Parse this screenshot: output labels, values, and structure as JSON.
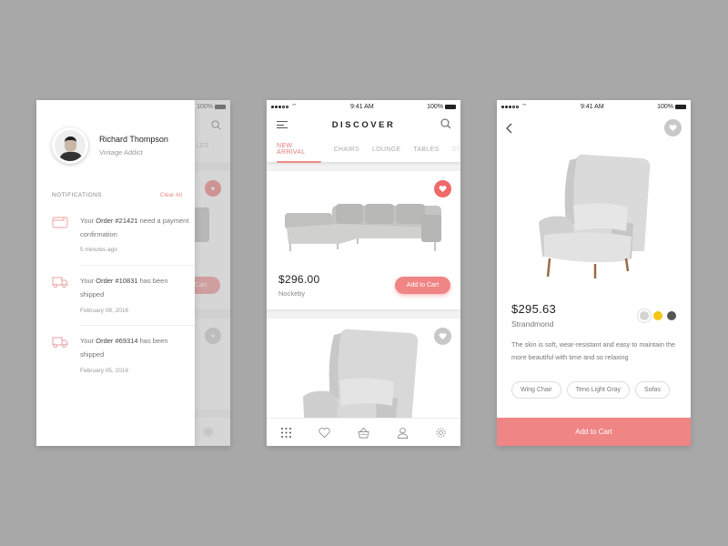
{
  "status_bar": {
    "time": "9:41 AM",
    "battery": "100%"
  },
  "drawer_screen": {
    "profile": {
      "name": "Richard Thompson",
      "subtitle": "Vintage Addict"
    },
    "notifications_title": "NOTIFICATIONS",
    "clear_all": "Clear All",
    "notifications": [
      {
        "icon": "wallet-icon",
        "prefix": "Your ",
        "order": "Order #21421",
        "suffix": " need a payment confirmation",
        "time": "5 minutes ago"
      },
      {
        "icon": "delivery-truck-icon",
        "prefix": "Your ",
        "order": "Order #10831",
        "suffix": " has been shipped",
        "time": "February 08, 2016"
      },
      {
        "icon": "delivery-truck-icon",
        "prefix": "Your ",
        "order": "Order #69314",
        "suffix": " has been shipped",
        "time": "February 05, 2016"
      }
    ],
    "underlay": {
      "tab_fragment": "LES",
      "cart_fragment": "Cart"
    }
  },
  "discover_screen": {
    "title": "DISCOVER",
    "tabs": [
      {
        "label": "NEW ARRIVAL",
        "active": true
      },
      {
        "label": "CHAIRS",
        "active": false
      },
      {
        "label": "LOUNGE",
        "active": false
      },
      {
        "label": "TABLES",
        "active": false
      },
      {
        "label": "ST",
        "active": false
      }
    ],
    "products": [
      {
        "price": "$296.00",
        "name": "Nockeby",
        "favorited": true,
        "cart_label": "Add to Cart"
      },
      {
        "favorited": false
      }
    ],
    "bottom_nav": [
      {
        "icon": "grid-icon",
        "active": true
      },
      {
        "icon": "heart-icon",
        "active": false
      },
      {
        "icon": "basket-icon",
        "active": false
      },
      {
        "icon": "user-icon",
        "active": false
      },
      {
        "icon": "gear-icon",
        "active": false
      }
    ]
  },
  "detail_screen": {
    "price": "$295.63",
    "name": "Strandmond",
    "description": "The skin is soft, wear-resistant and easy to maintain the more beautiful with time and so relaxing",
    "colors": [
      "#d4d4d4",
      "#f5c518",
      "#555555"
    ],
    "selected_color_index": 0,
    "tags": [
      "Wing Chair",
      "Teno Light Gray",
      "Sofas"
    ],
    "cart_label": "Add to Cart"
  },
  "theme": {
    "accent": "#ef8585",
    "background": "#a8a8a8"
  }
}
